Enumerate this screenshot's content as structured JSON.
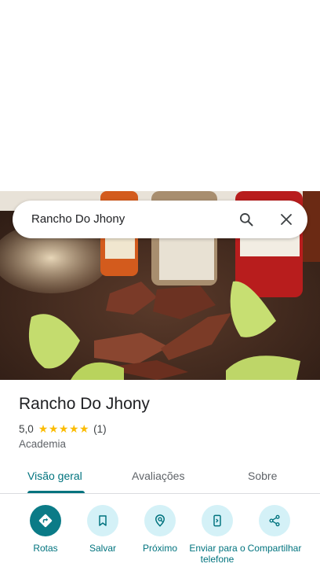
{
  "search": {
    "query": "Rancho Do Jhony",
    "icons": [
      "search-icon",
      "close-icon"
    ]
  },
  "place": {
    "name": "Rancho Do Jhony",
    "rating": "5,0",
    "rating_value": 5,
    "review_count": "(1)",
    "category": "Academia"
  },
  "tabs": [
    {
      "label": "Visão geral",
      "active": true
    },
    {
      "label": "Avaliações",
      "active": false
    },
    {
      "label": "Sobre",
      "active": false
    }
  ],
  "actions": [
    {
      "label": "Rotas",
      "icon": "directions-icon"
    },
    {
      "label": "Salvar",
      "icon": "bookmark-icon"
    },
    {
      "label": "Próximo",
      "icon": "nearby-icon"
    },
    {
      "label": "Enviar para o telefone",
      "icon": "send-to-phone-icon"
    },
    {
      "label": "Compartilhar",
      "icon": "share-icon"
    }
  ],
  "colors": {
    "accent": "#00737e",
    "primary_button": "#0b7b87",
    "button_bg": "#d4f1f7",
    "star": "#fbbc04"
  }
}
